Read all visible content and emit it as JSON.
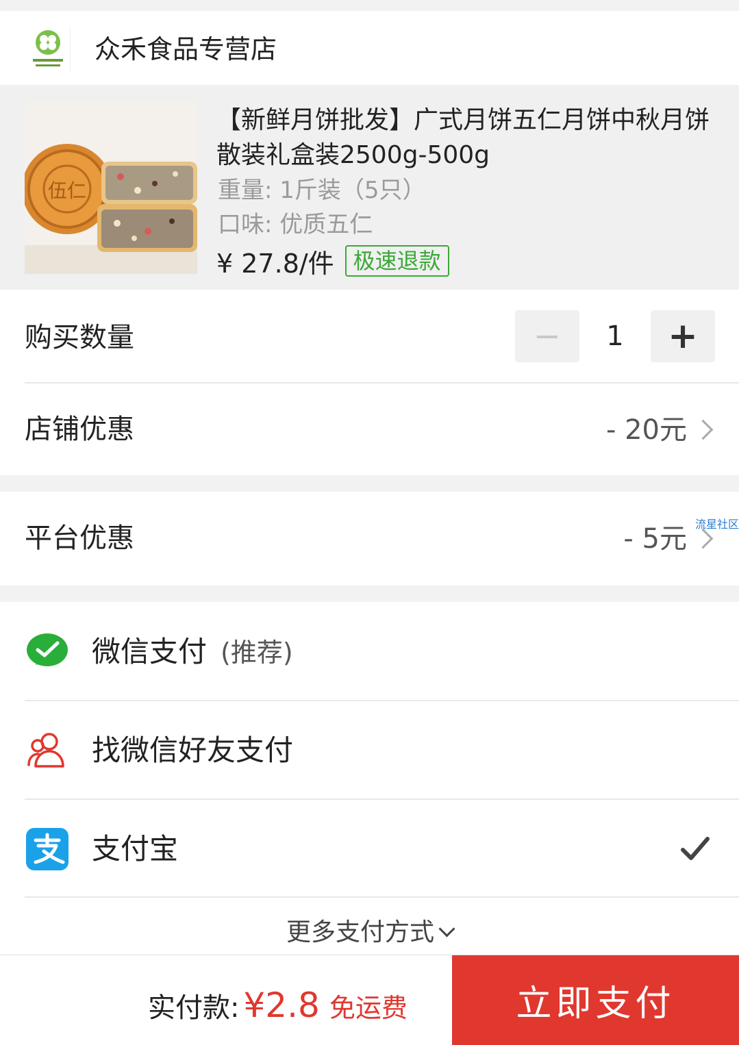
{
  "store": {
    "name": "众禾食品专营店",
    "logo_icon": "clover-logo-icon"
  },
  "product": {
    "title": "【新鲜月饼批发】广式月饼五仁月饼中秋月饼散装礼盒装2500g-500g",
    "weight": "重量: 1斤装（5只）",
    "flavor": "口味: 优质五仁",
    "price": "¥ 27.8/件",
    "badge": "极速退款",
    "mooncake_stamp": "伍仁"
  },
  "quantity": {
    "label": "购买数量",
    "minus": "−",
    "value": "1",
    "plus": "+"
  },
  "store_discount": {
    "label": "店铺优惠",
    "value": "- 20元"
  },
  "platform_discount": {
    "label": "平台优惠",
    "value": "- 5元",
    "watermark": "流星社区"
  },
  "payment": {
    "wechat": {
      "label": "微信支付",
      "note": "(推荐)"
    },
    "friend": {
      "label": "找微信好友支付"
    },
    "alipay": {
      "label": "支付宝",
      "selected": true
    },
    "more": "更多支付方式"
  },
  "footer": {
    "total_label": "实付款:",
    "total_amount": "¥2.8",
    "shipping": "免运费",
    "pay_button": "立即支付"
  },
  "colors": {
    "accent": "#e0382f",
    "badge_green": "#3aa836",
    "wechat_green": "#2aae3a",
    "alipay_blue": "#1aa1e8"
  }
}
